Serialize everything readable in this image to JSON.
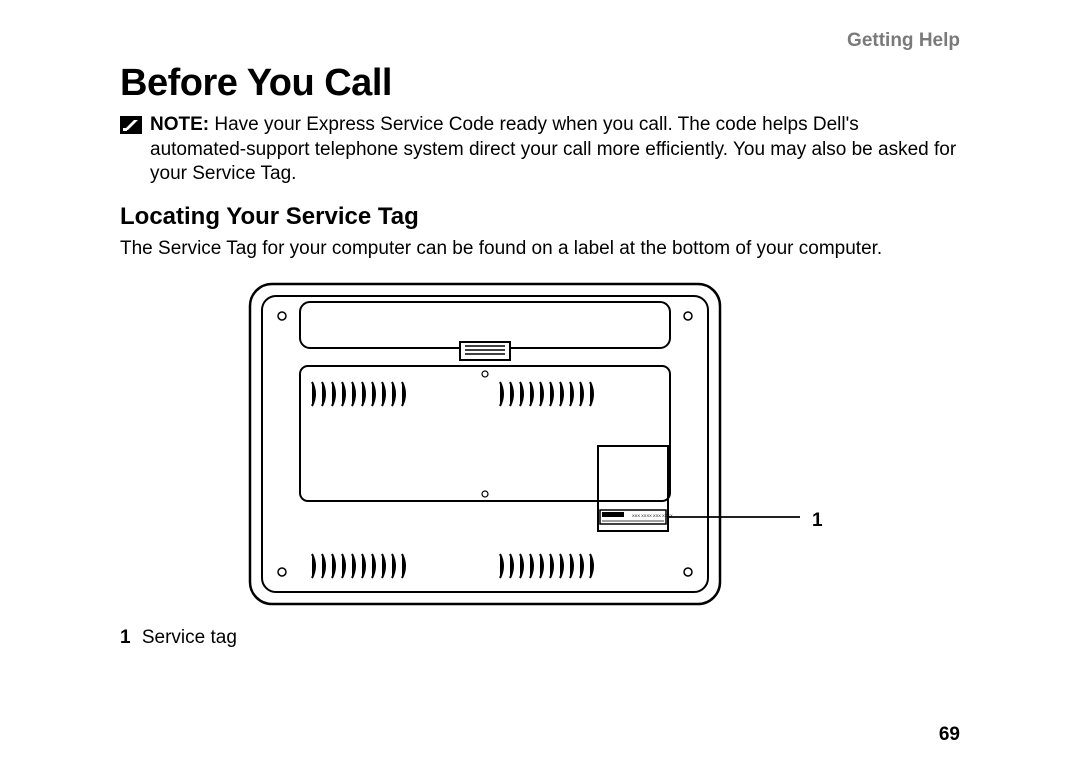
{
  "header": {
    "section": "Getting Help"
  },
  "title": "Before You Call",
  "note": {
    "label": "NOTE:",
    "body": "Have your Express Service Code ready when you call. The code helps Dell's automated-support telephone system direct your call more efficiently. You may also be asked for your Service Tag."
  },
  "subheading": "Locating Your Service Tag",
  "body": "The Service Tag for your computer can be found on a label at the bottom of your computer.",
  "figure": {
    "callout_number": "1",
    "legend_number": "1",
    "legend_text": "Service tag"
  },
  "page_number": "69"
}
